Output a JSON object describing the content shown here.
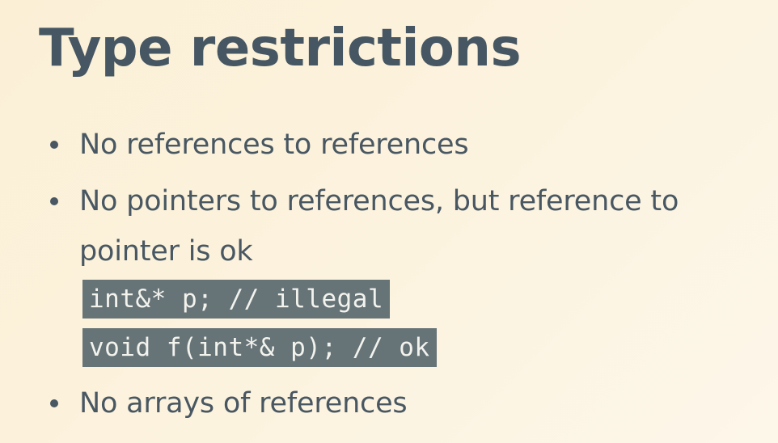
{
  "slide": {
    "title": "Type restrictions",
    "bullets": [
      {
        "text": "No references to references"
      },
      {
        "text": "No pointers to references, but reference to pointer is ok"
      },
      {
        "text": "No arrays of references"
      }
    ],
    "code_lines": [
      "int&* p; // illegal",
      "void f(int*& p); // ok"
    ]
  },
  "colors": {
    "background": "#fcf3df",
    "text": "#485762",
    "code_background": "#667377",
    "code_text": "#f3f3ee"
  }
}
